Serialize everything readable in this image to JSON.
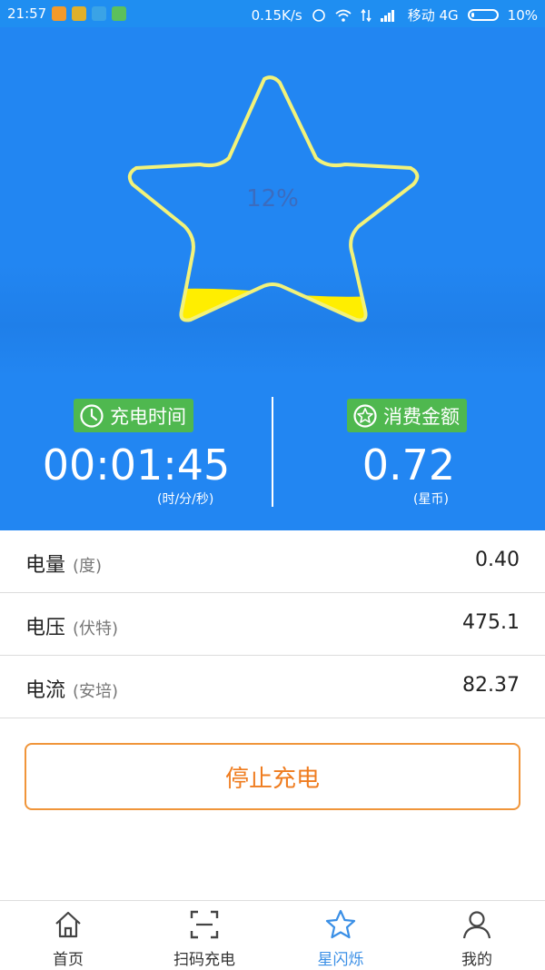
{
  "status_bar": {
    "time": "21:57",
    "net_speed": "0.15K/s",
    "carrier": "移动 4G",
    "battery": "10%"
  },
  "charge": {
    "percent_label": "12%",
    "fill_fraction": 0.12
  },
  "charge_time": {
    "badge_label": "充电时间",
    "value": "00:01:45",
    "unit": "(时/分/秒)"
  },
  "cost": {
    "badge_label": "消费金额",
    "value": "0.72",
    "unit": "(星币)"
  },
  "metrics": [
    {
      "label": "电量",
      "unit": "(度)",
      "value": "0.40"
    },
    {
      "label": "电压",
      "unit": "(伏特)",
      "value": "475.1"
    },
    {
      "label": "电流",
      "unit": "(安培)",
      "value": "82.37"
    }
  ],
  "stop_button": "停止充电",
  "nav": [
    {
      "label": "首页",
      "icon": "home-icon"
    },
    {
      "label": "扫码充电",
      "icon": "scan-icon"
    },
    {
      "label": "星闪烁",
      "icon": "star-icon",
      "active": true
    },
    {
      "label": "我的",
      "icon": "person-icon"
    }
  ],
  "colors": {
    "hero_bg": "#2286f2",
    "star_outline": "#f2f27a",
    "star_fill": "#ffee00",
    "badge_green": "#4fb84f",
    "stop_orange": "#ef7c1f",
    "nav_active": "#3a8fe6"
  }
}
